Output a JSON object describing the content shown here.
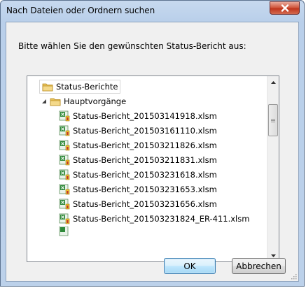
{
  "window": {
    "title": "Nach Dateien oder Ordnern suchen"
  },
  "dialog": {
    "prompt": "Bitte wählen Sie den gewünschten Status-Bericht aus:"
  },
  "tree": {
    "root": {
      "label": "Status-Berichte",
      "icon": "folder-icon"
    },
    "folder": {
      "label": "Hauptvorgänge",
      "icon": "folder-icon",
      "expanded": true
    },
    "files": [
      {
        "label": "Status-Bericht_201503141918.xlsm",
        "icon": "excel-macro-file-icon"
      },
      {
        "label": "Status-Bericht_201503161110.xlsm",
        "icon": "excel-macro-file-icon"
      },
      {
        "label": "Status-Bericht_201503211826.xlsm",
        "icon": "excel-macro-file-icon"
      },
      {
        "label": "Status-Bericht_201503211831.xlsm",
        "icon": "excel-macro-file-icon"
      },
      {
        "label": "Status-Bericht_201503231618.xlsm",
        "icon": "excel-macro-file-icon"
      },
      {
        "label": "Status-Bericht_201503231653.xlsm",
        "icon": "excel-macro-file-icon"
      },
      {
        "label": "Status-Bericht_201503231656.xlsm",
        "icon": "excel-macro-file-icon"
      },
      {
        "label": "Status-Bericht_201503231824_ER-411.xlsm",
        "icon": "excel-macro-file-icon"
      }
    ]
  },
  "buttons": {
    "ok": "OK",
    "cancel": "Abbrechen"
  },
  "colors": {
    "titlebar": "#c7d9ef",
    "close": "#c0351d",
    "folder": "#e8c25a",
    "excel": "#2f8a3a",
    "default_button_border": "#3c7fb1"
  }
}
